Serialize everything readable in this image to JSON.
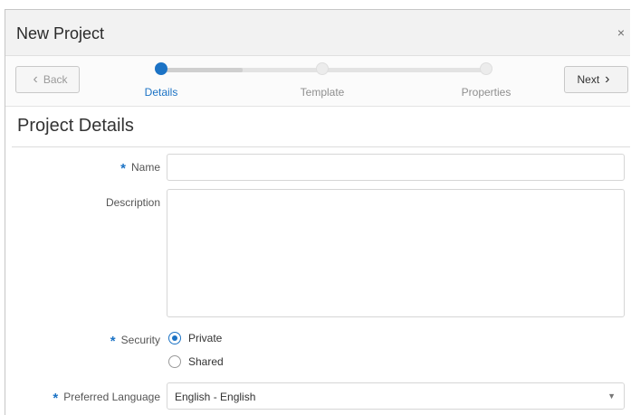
{
  "dialog": {
    "title": "New Project",
    "close_icon": "close-icon",
    "close_glyph": "×"
  },
  "train": {
    "back_label": "Back",
    "next_label": "Next",
    "back_glyph": "‹",
    "next_glyph": "›",
    "steps": [
      {
        "label": "Details",
        "state": "current"
      },
      {
        "label": "Template",
        "state": "upcoming"
      },
      {
        "label": "Properties",
        "state": "upcoming"
      }
    ]
  },
  "section": {
    "title": "Project Details"
  },
  "form": {
    "required_marker": "*",
    "name": {
      "label": "Name",
      "value": ""
    },
    "description": {
      "label": "Description",
      "value": ""
    },
    "security": {
      "label": "Security",
      "options": [
        {
          "label": "Private",
          "checked": true
        },
        {
          "label": "Shared",
          "checked": false
        }
      ]
    },
    "preferred_language": {
      "label": "Preferred Language",
      "value": "English - English",
      "caret_glyph": "▼"
    }
  },
  "colors": {
    "accent": "#1c73c5",
    "header_bg": "#f2f2f2"
  }
}
